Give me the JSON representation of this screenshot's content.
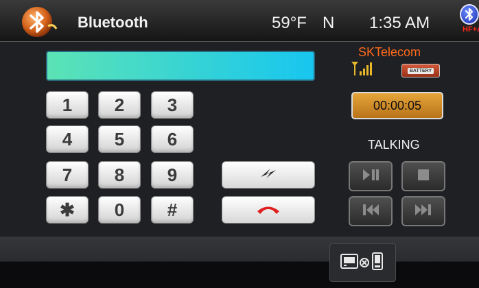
{
  "header": {
    "title": "Bluetooth",
    "temperature": "59°F",
    "heading": "N",
    "time": "1:35 AM",
    "bt_mode": "HF+AV",
    "icons": {
      "logo": "bluetooth-logo",
      "bt": "bluetooth-icon"
    }
  },
  "dialer": {
    "display_value": "",
    "keys": [
      "1",
      "2",
      "3",
      "4",
      "5",
      "6",
      "7",
      "8",
      "9",
      "✱",
      "0",
      "#"
    ],
    "call_icon": "call-swap-icon",
    "hangup_icon": "hang-up-icon"
  },
  "call_info": {
    "carrier": "SKTelecom",
    "battery_label": "BATTERY",
    "timer": "00:00:05",
    "status": "TALKING"
  },
  "media_controls": [
    "play-pause-icon",
    "stop-icon",
    "previous-track-icon",
    "next-track-icon"
  ],
  "bottom": {
    "device_switch_icon": "device-switch-icon"
  },
  "colors": {
    "display_gradient_start": "#5ce3b5",
    "display_gradient_end": "#17c6ef",
    "carrier": "#ff6a1a",
    "timer_bg": "#e6a53a",
    "hangup": "#e02020"
  }
}
